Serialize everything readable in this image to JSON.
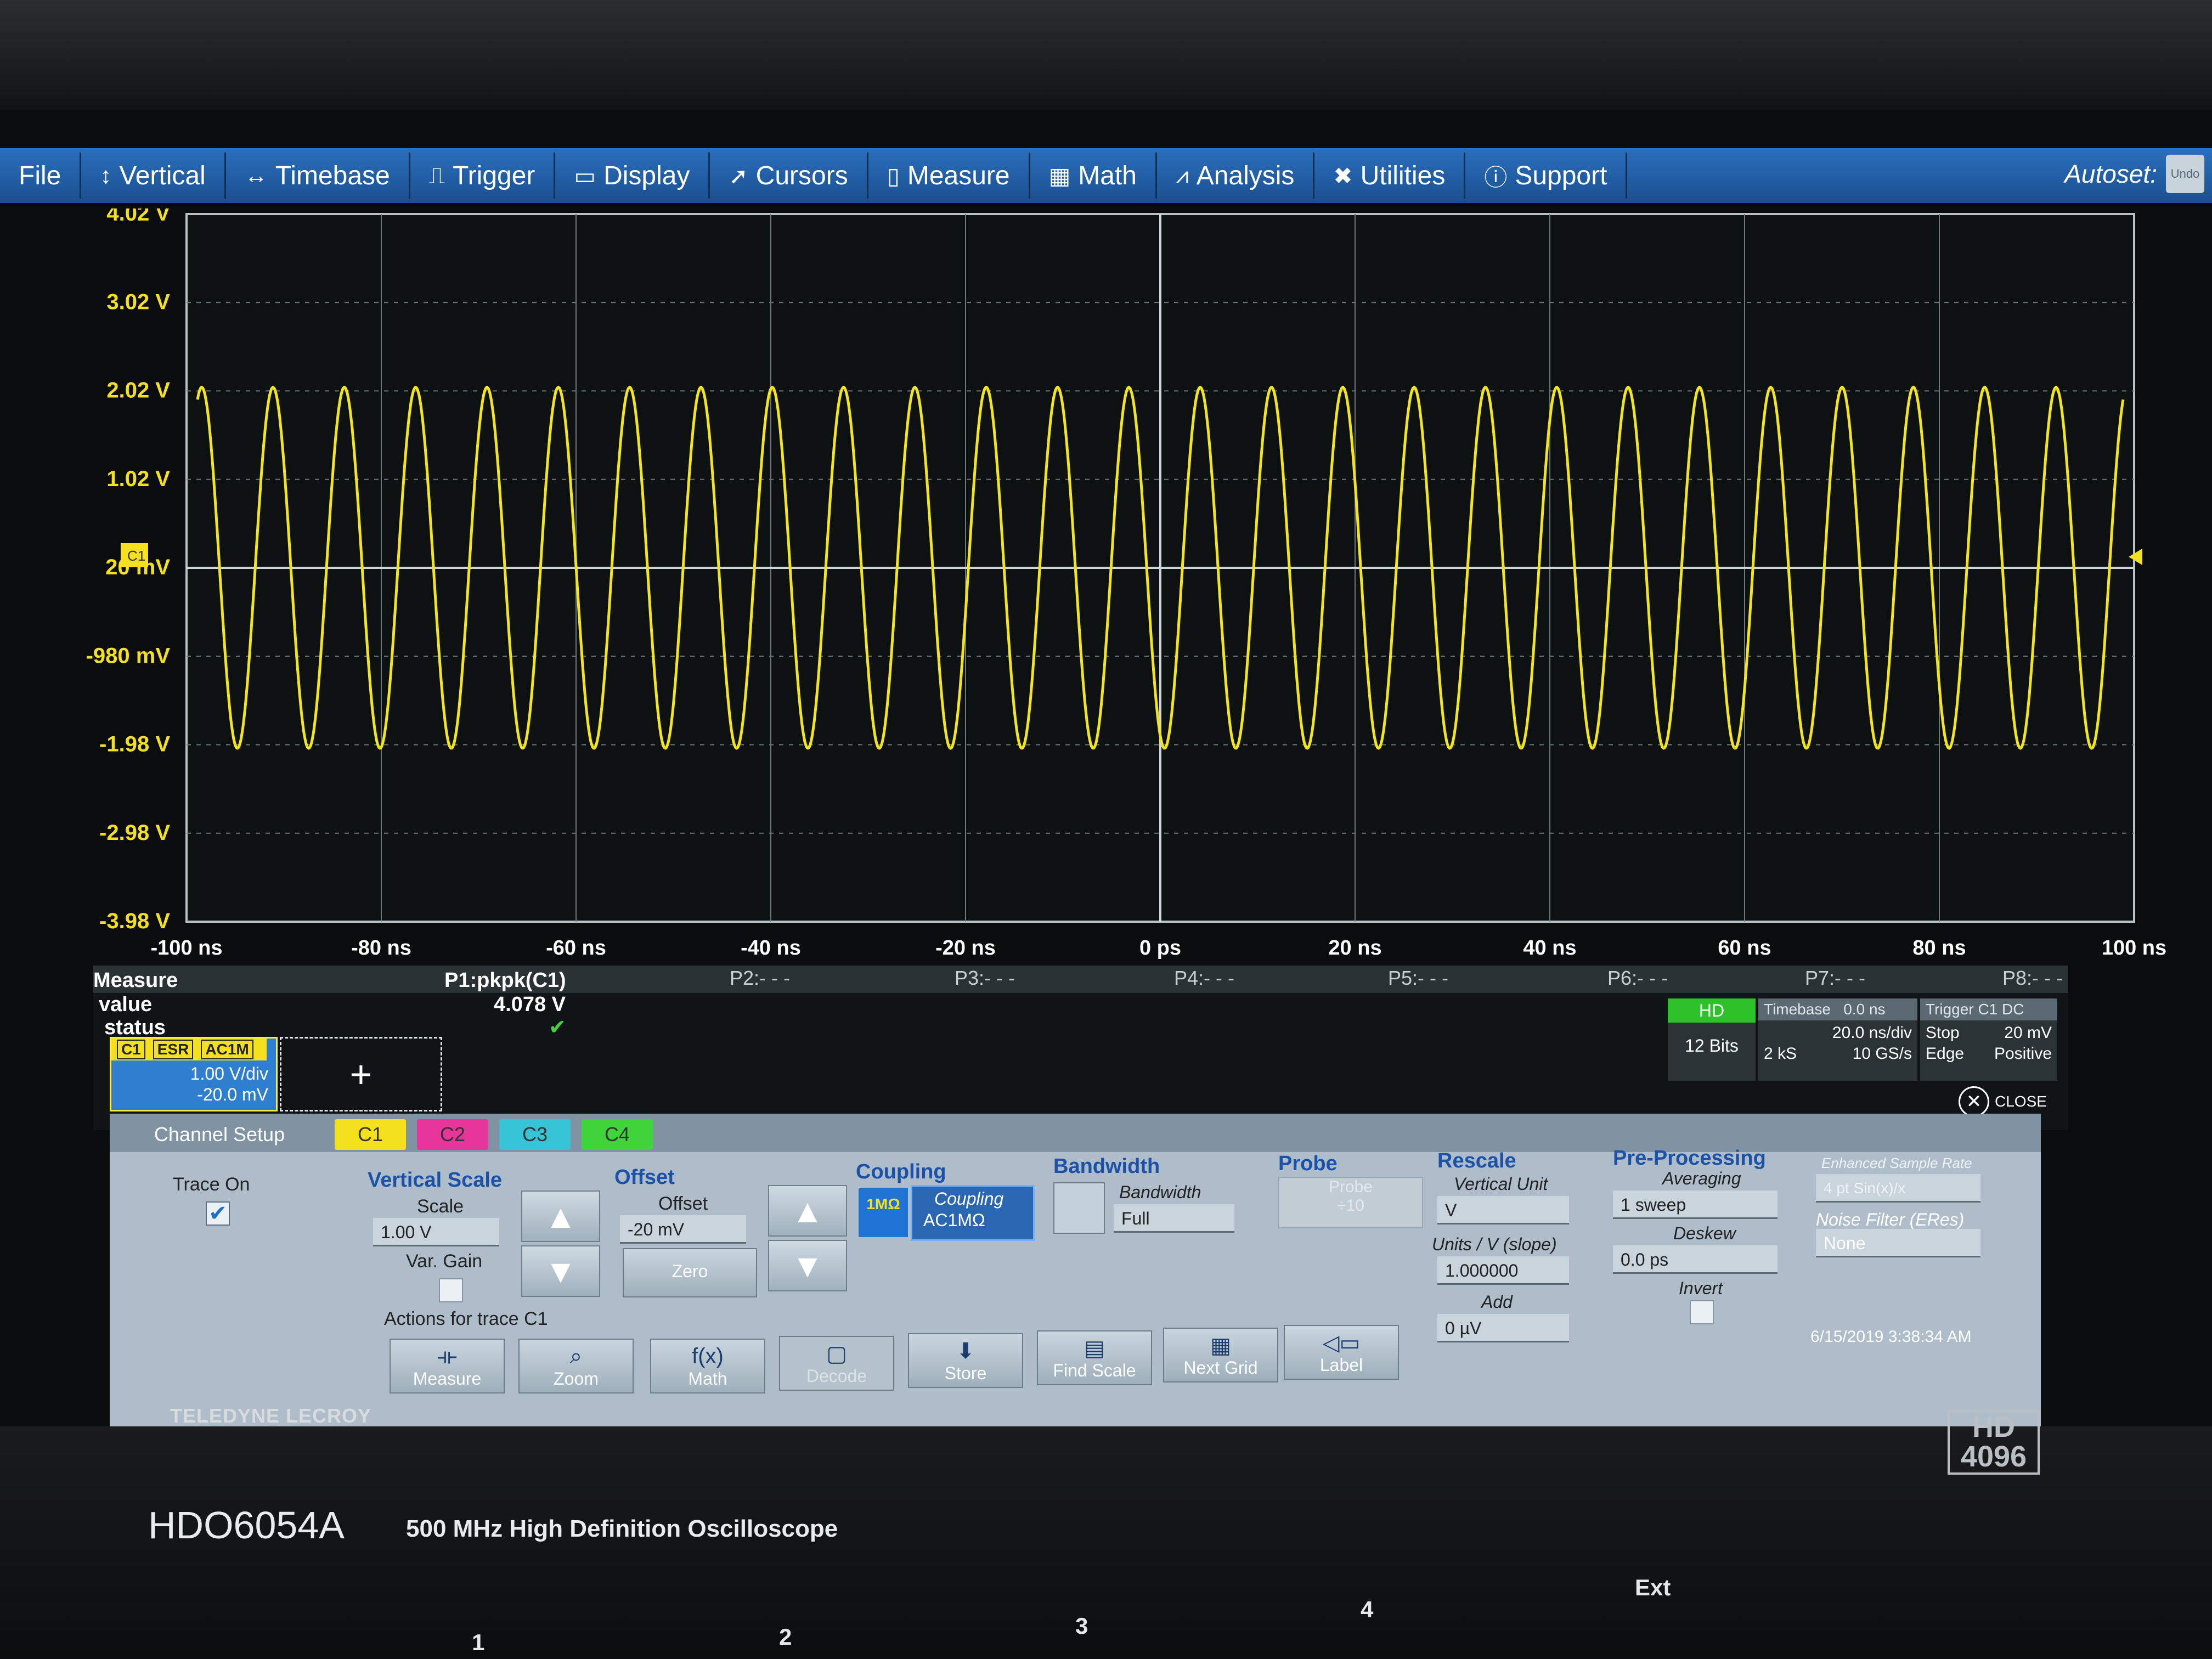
{
  "menu": {
    "items": [
      {
        "label": "File",
        "icon": ""
      },
      {
        "label": "Vertical",
        "icon": "vertical-arrows-icon"
      },
      {
        "label": "Timebase",
        "icon": "horizontal-arrows-icon"
      },
      {
        "label": "Trigger",
        "icon": "trigger-icon"
      },
      {
        "label": "Display",
        "icon": "display-icon"
      },
      {
        "label": "Cursors",
        "icon": "cursor-icon"
      },
      {
        "label": "Measure",
        "icon": "measure-icon"
      },
      {
        "label": "Math",
        "icon": "math-icon"
      },
      {
        "label": "Analysis",
        "icon": "chart-icon"
      },
      {
        "label": "Utilities",
        "icon": "wrench-icon"
      },
      {
        "label": "Support",
        "icon": "info-icon"
      }
    ],
    "autoset_label": "Autoset:",
    "undo_label": "Undo"
  },
  "waveform": {
    "y_labels": [
      "4.02 V",
      "3.02 V",
      "2.02 V",
      "1.02 V",
      "20 mV",
      "-980 mV",
      "-1.98 V",
      "-2.98 V",
      "-3.98 V"
    ],
    "x_labels": [
      "-100 ns",
      "-80 ns",
      "-60 ns",
      "-40 ns",
      "-20 ns",
      "0 ps",
      "20 ns",
      "40 ns",
      "60 ns",
      "80 ns",
      "100 ns"
    ],
    "ground_marker": "C1",
    "trace_color": "#f2e51c",
    "cycles": 27,
    "amplitude_v": 2.04
  },
  "measure": {
    "title": "Measure",
    "row_value": "value",
    "row_status": "status",
    "params": [
      "P1:pkpk(C1)",
      "P2:- - -",
      "P3:- - -",
      "P4:- - -",
      "P5:- - -",
      "P6:- - -",
      "P7:- - -",
      "P8:- - -"
    ],
    "p1_value": "4.078 V"
  },
  "c1_descriptor": {
    "tags": [
      "C1",
      "ESR",
      "AC1M"
    ],
    "scale": "1.00 V/div",
    "offset": "-20.0 mV"
  },
  "status": {
    "hd_label": "HD",
    "bits": "12 Bits",
    "timebase_title": "Timebase",
    "timebase_delay": "0.0 ns",
    "timebase_rate": "20.0 ns/div",
    "samples": "2 kS",
    "sample_rate": "10 GS/s",
    "trigger_title": "Trigger",
    "trigger_tags": "C1 DC",
    "trigger_mode": "Stop",
    "trigger_type": "Edge",
    "trigger_level": "20 mV",
    "trigger_slope": "Positive",
    "close_label": "CLOSE"
  },
  "dialog": {
    "title": "Channel Setup",
    "tabs": [
      "C1",
      "C2",
      "C3",
      "C4"
    ],
    "trace_on": "Trace On",
    "vertical_scale_head": "Vertical Scale",
    "scale_label": "Scale",
    "scale_value": "1.00 V",
    "var_gain": "Var. Gain",
    "offset_head": "Offset",
    "offset_label": "Offset",
    "offset_value": "-20 mV",
    "zero_label": "Zero",
    "coupling_head": "Coupling",
    "coupling_badge": "1MΩ",
    "coupling_label": "Coupling",
    "coupling_value": "AC1MΩ",
    "bandwidth_head": "Bandwidth",
    "bandwidth_label": "Bandwidth",
    "bandwidth_value": "Full",
    "probe_head": "Probe",
    "probe_label": "Probe",
    "probe_value": "÷10",
    "rescale_head": "Rescale",
    "vertical_unit_label": "Vertical Unit",
    "vertical_unit_value": "V",
    "units_slope_label": "Units / V (slope)",
    "units_slope_value": "1.000000",
    "add_label": "Add",
    "add_value": "0 µV",
    "preproc_head": "Pre-Processing",
    "averaging_label": "Averaging",
    "averaging_value": "1 sweep",
    "deskew_label": "Deskew",
    "deskew_value": "0.0 ps",
    "invert_label": "Invert",
    "esr_label": "Enhanced Sample Rate",
    "esr_value": "4 pt Sin(x)/x",
    "noise_label": "Noise Filter (ERes)",
    "noise_value": "None",
    "actions_label": "Actions for trace C1",
    "actions": [
      "Measure",
      "Zoom",
      "Math",
      "Decode",
      "Store",
      "Find Scale",
      "Next Grid",
      "Label"
    ],
    "timestamp": "6/15/2019 3:38:34 AM"
  },
  "hardware": {
    "brand": "TELEDYNE LECROY",
    "model": "HDO6054A",
    "model_desc": "500 MHz High Definition Oscilloscope",
    "hd_badge": "HD 4096",
    "ports": [
      "1",
      "2",
      "3",
      "4",
      "Ext"
    ]
  },
  "colors": {
    "c1": "#f4e01d",
    "c2": "#e8359b",
    "c3": "#36c3d6",
    "c4": "#3fd43a",
    "menu_bar": "#2a6fbd",
    "dialog_bg": "#aebdc9"
  }
}
